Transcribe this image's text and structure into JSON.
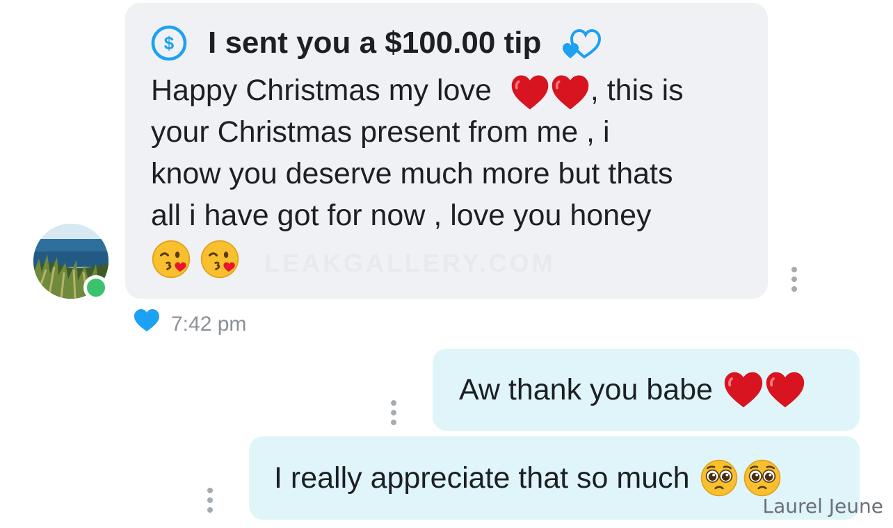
{
  "incoming": {
    "tip_title": "I sent you a $100.00 tip",
    "message_line_1_before_emoji": "Happy Christmas my love",
    "message_line_1_after_emoji": ", this is",
    "message_line_2": "your Christmas present from me , i",
    "message_line_3": "know you deserve much more but thats",
    "message_line_4": "all i have got for now , love you honey",
    "watermark": "LEAKGALLERY.COM",
    "timestamp": "7:42 pm",
    "sender_online": true,
    "liked": true
  },
  "outgoing": [
    {
      "text": "Aw thank you babe"
    },
    {
      "text": "I really appreciate that so much"
    }
  ],
  "author_credit": "Laurel Jeune",
  "colors": {
    "accent": "#1da1f2",
    "incoming_bubble": "#eff1f4",
    "outgoing_bubble": "#dff5f9",
    "online": "#3cc26d",
    "timestamp": "#8a9097"
  },
  "icons": {
    "tip": "dollar-circle-icon",
    "tip_decoration": "double-heart-outline-icon",
    "like": "heart-filled-icon",
    "menu": "kebab-menu-icon",
    "emoji_red_heart": "red-heart-emoji",
    "emoji_kiss": "kissing-face-emoji",
    "emoji_pleading": "pleading-face-emoji"
  }
}
